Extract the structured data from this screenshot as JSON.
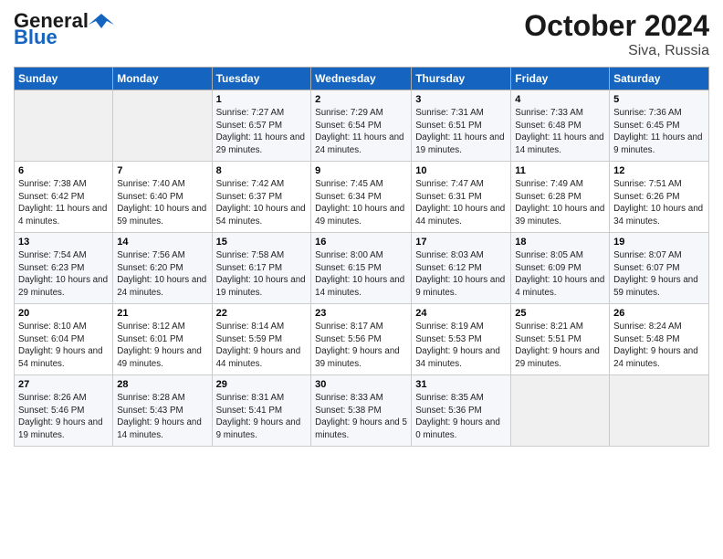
{
  "header": {
    "logo_general": "General",
    "logo_blue": "Blue",
    "month_year": "October 2024",
    "location": "Siva, Russia"
  },
  "days_of_week": [
    "Sunday",
    "Monday",
    "Tuesday",
    "Wednesday",
    "Thursday",
    "Friday",
    "Saturday"
  ],
  "weeks": [
    [
      {
        "day": "",
        "empty": true
      },
      {
        "day": "",
        "empty": true
      },
      {
        "day": "1",
        "sunrise": "Sunrise: 7:27 AM",
        "sunset": "Sunset: 6:57 PM",
        "daylight": "Daylight: 11 hours and 29 minutes."
      },
      {
        "day": "2",
        "sunrise": "Sunrise: 7:29 AM",
        "sunset": "Sunset: 6:54 PM",
        "daylight": "Daylight: 11 hours and 24 minutes."
      },
      {
        "day": "3",
        "sunrise": "Sunrise: 7:31 AM",
        "sunset": "Sunset: 6:51 PM",
        "daylight": "Daylight: 11 hours and 19 minutes."
      },
      {
        "day": "4",
        "sunrise": "Sunrise: 7:33 AM",
        "sunset": "Sunset: 6:48 PM",
        "daylight": "Daylight: 11 hours and 14 minutes."
      },
      {
        "day": "5",
        "sunrise": "Sunrise: 7:36 AM",
        "sunset": "Sunset: 6:45 PM",
        "daylight": "Daylight: 11 hours and 9 minutes."
      }
    ],
    [
      {
        "day": "6",
        "sunrise": "Sunrise: 7:38 AM",
        "sunset": "Sunset: 6:42 PM",
        "daylight": "Daylight: 11 hours and 4 minutes."
      },
      {
        "day": "7",
        "sunrise": "Sunrise: 7:40 AM",
        "sunset": "Sunset: 6:40 PM",
        "daylight": "Daylight: 10 hours and 59 minutes."
      },
      {
        "day": "8",
        "sunrise": "Sunrise: 7:42 AM",
        "sunset": "Sunset: 6:37 PM",
        "daylight": "Daylight: 10 hours and 54 minutes."
      },
      {
        "day": "9",
        "sunrise": "Sunrise: 7:45 AM",
        "sunset": "Sunset: 6:34 PM",
        "daylight": "Daylight: 10 hours and 49 minutes."
      },
      {
        "day": "10",
        "sunrise": "Sunrise: 7:47 AM",
        "sunset": "Sunset: 6:31 PM",
        "daylight": "Daylight: 10 hours and 44 minutes."
      },
      {
        "day": "11",
        "sunrise": "Sunrise: 7:49 AM",
        "sunset": "Sunset: 6:28 PM",
        "daylight": "Daylight: 10 hours and 39 minutes."
      },
      {
        "day": "12",
        "sunrise": "Sunrise: 7:51 AM",
        "sunset": "Sunset: 6:26 PM",
        "daylight": "Daylight: 10 hours and 34 minutes."
      }
    ],
    [
      {
        "day": "13",
        "sunrise": "Sunrise: 7:54 AM",
        "sunset": "Sunset: 6:23 PM",
        "daylight": "Daylight: 10 hours and 29 minutes."
      },
      {
        "day": "14",
        "sunrise": "Sunrise: 7:56 AM",
        "sunset": "Sunset: 6:20 PM",
        "daylight": "Daylight: 10 hours and 24 minutes."
      },
      {
        "day": "15",
        "sunrise": "Sunrise: 7:58 AM",
        "sunset": "Sunset: 6:17 PM",
        "daylight": "Daylight: 10 hours and 19 minutes."
      },
      {
        "day": "16",
        "sunrise": "Sunrise: 8:00 AM",
        "sunset": "Sunset: 6:15 PM",
        "daylight": "Daylight: 10 hours and 14 minutes."
      },
      {
        "day": "17",
        "sunrise": "Sunrise: 8:03 AM",
        "sunset": "Sunset: 6:12 PM",
        "daylight": "Daylight: 10 hours and 9 minutes."
      },
      {
        "day": "18",
        "sunrise": "Sunrise: 8:05 AM",
        "sunset": "Sunset: 6:09 PM",
        "daylight": "Daylight: 10 hours and 4 minutes."
      },
      {
        "day": "19",
        "sunrise": "Sunrise: 8:07 AM",
        "sunset": "Sunset: 6:07 PM",
        "daylight": "Daylight: 9 hours and 59 minutes."
      }
    ],
    [
      {
        "day": "20",
        "sunrise": "Sunrise: 8:10 AM",
        "sunset": "Sunset: 6:04 PM",
        "daylight": "Daylight: 9 hours and 54 minutes."
      },
      {
        "day": "21",
        "sunrise": "Sunrise: 8:12 AM",
        "sunset": "Sunset: 6:01 PM",
        "daylight": "Daylight: 9 hours and 49 minutes."
      },
      {
        "day": "22",
        "sunrise": "Sunrise: 8:14 AM",
        "sunset": "Sunset: 5:59 PM",
        "daylight": "Daylight: 9 hours and 44 minutes."
      },
      {
        "day": "23",
        "sunrise": "Sunrise: 8:17 AM",
        "sunset": "Sunset: 5:56 PM",
        "daylight": "Daylight: 9 hours and 39 minutes."
      },
      {
        "day": "24",
        "sunrise": "Sunrise: 8:19 AM",
        "sunset": "Sunset: 5:53 PM",
        "daylight": "Daylight: 9 hours and 34 minutes."
      },
      {
        "day": "25",
        "sunrise": "Sunrise: 8:21 AM",
        "sunset": "Sunset: 5:51 PM",
        "daylight": "Daylight: 9 hours and 29 minutes."
      },
      {
        "day": "26",
        "sunrise": "Sunrise: 8:24 AM",
        "sunset": "Sunset: 5:48 PM",
        "daylight": "Daylight: 9 hours and 24 minutes."
      }
    ],
    [
      {
        "day": "27",
        "sunrise": "Sunrise: 8:26 AM",
        "sunset": "Sunset: 5:46 PM",
        "daylight": "Daylight: 9 hours and 19 minutes."
      },
      {
        "day": "28",
        "sunrise": "Sunrise: 8:28 AM",
        "sunset": "Sunset: 5:43 PM",
        "daylight": "Daylight: 9 hours and 14 minutes."
      },
      {
        "day": "29",
        "sunrise": "Sunrise: 8:31 AM",
        "sunset": "Sunset: 5:41 PM",
        "daylight": "Daylight: 9 hours and 9 minutes."
      },
      {
        "day": "30",
        "sunrise": "Sunrise: 8:33 AM",
        "sunset": "Sunset: 5:38 PM",
        "daylight": "Daylight: 9 hours and 5 minutes."
      },
      {
        "day": "31",
        "sunrise": "Sunrise: 8:35 AM",
        "sunset": "Sunset: 5:36 PM",
        "daylight": "Daylight: 9 hours and 0 minutes."
      },
      {
        "day": "",
        "empty": true
      },
      {
        "day": "",
        "empty": true
      }
    ]
  ]
}
